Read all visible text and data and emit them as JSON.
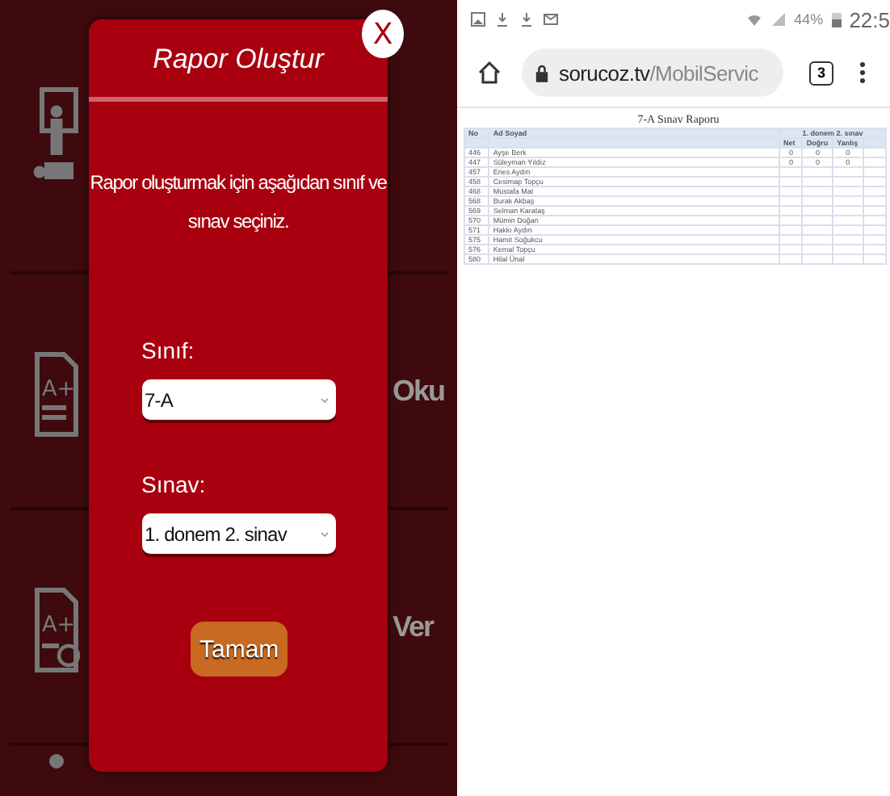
{
  "app_menu": [
    {
      "kind": "teacher"
    },
    {
      "kind": "grade",
      "badge": "A+",
      "label": "Oku"
    },
    {
      "kind": "grade-clock",
      "badge": "A+",
      "label": "Ver"
    },
    {
      "kind": "person"
    }
  ],
  "dialog": {
    "title": "Rapor Oluştur",
    "close_label": "X",
    "message": "Rapor oluşturmak için aşağıdan sınıf ve sınav seçiniz.",
    "fields": [
      {
        "label": "Sınıf:",
        "value": "7-A"
      },
      {
        "label": "Sınav:",
        "value": "1. donem 2. sinav"
      }
    ],
    "button": "Tamam"
  },
  "status_bar": {
    "battery": "44%",
    "time": "22:5"
  },
  "browser": {
    "domain": "sorucoz.tv",
    "path": "/MobilServic",
    "tab_count": "3"
  },
  "report": {
    "title": "7-A Sınav Raporu",
    "columns": [
      "No",
      "Ad Soyad"
    ],
    "group_header": "1. donem 2. sınav",
    "sub_columns": [
      "Net",
      "Doğru",
      "Yanlış"
    ],
    "rows": [
      {
        "no": "446",
        "name": "Ayşe Berk",
        "values": [
          "0",
          "0",
          "0"
        ]
      },
      {
        "no": "447",
        "name": "Süleyman Yıldız",
        "values": [
          "0",
          "0",
          "0"
        ]
      },
      {
        "no": "457",
        "name": "Enes Aydın",
        "values": []
      },
      {
        "no": "458",
        "name": "Cesimap Topçu",
        "values": []
      },
      {
        "no": "468",
        "name": "Mustafa Mat",
        "values": []
      },
      {
        "no": "568",
        "name": "Burak Akbaş",
        "values": []
      },
      {
        "no": "569",
        "name": "Selman Karataş",
        "values": []
      },
      {
        "no": "570",
        "name": "Mümin Doğan",
        "values": []
      },
      {
        "no": "571",
        "name": "Hakkı Aydın",
        "values": []
      },
      {
        "no": "575",
        "name": "Hamit Soğukcu",
        "values": []
      },
      {
        "no": "576",
        "name": "Kemal Topçu",
        "values": []
      },
      {
        "no": "580",
        "name": "Hilal Ünal",
        "values": []
      }
    ]
  }
}
